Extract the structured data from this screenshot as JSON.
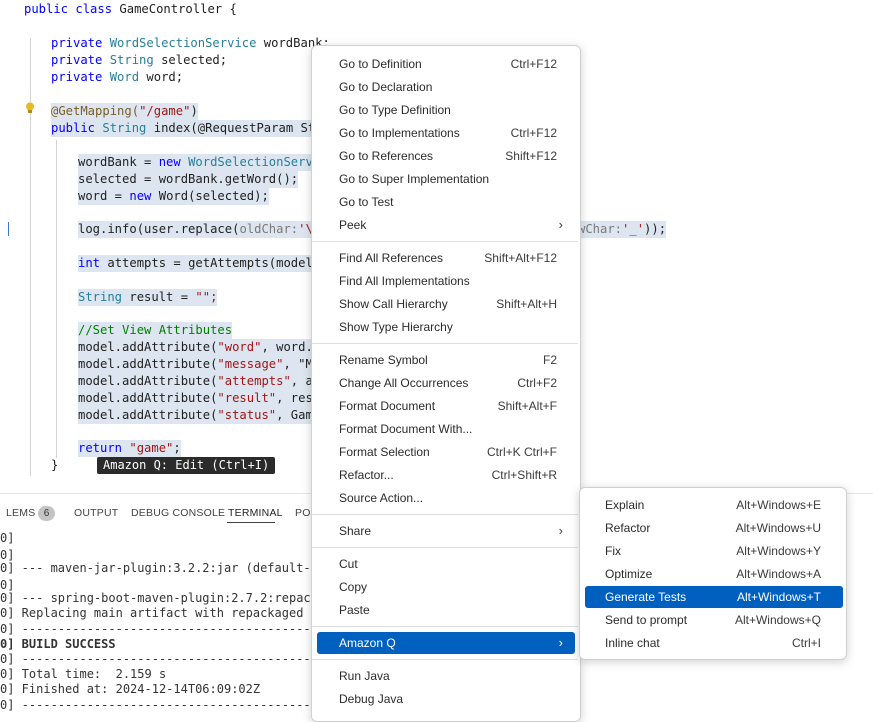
{
  "code": {
    "line1": {
      "kw": "public class ",
      "name": "GameController {"
    },
    "line2": {
      "kw": "private ",
      "ty": "WordSelectionService",
      "rest": " wordBank;"
    },
    "line3": {
      "kw": "private ",
      "ty": "String",
      "rest": " selected;"
    },
    "line4": {
      "kw": "private ",
      "ty": "Word",
      "rest": " word;"
    },
    "line5": {
      "ann": "@GetMapping(",
      "str": "\"/game\"",
      "end": ")"
    },
    "line6": {
      "kw": "public ",
      "ty": "String",
      "rest": " index(@RequestParam Stri"
    },
    "line7": {
      "a": "wordBank = ",
      "kw": "new ",
      "b": "WordSelectionServic"
    },
    "line8": {
      "a": "selected = wordBank.getWord();"
    },
    "line9": {
      "a": "word = ",
      "kw": "new ",
      "b": "Word(selected);"
    },
    "line10": {
      "a": "log.info(user.replace(",
      "param1": "oldChar:",
      "str1": "'\\n'",
      "tail_param": "wChar:",
      "str2": "'_'",
      "tail": "));"
    },
    "line11": {
      "kw": "int ",
      "a": "attempts = getAttempts(model);"
    },
    "line12": {
      "ty": "String ",
      "a": "result = ",
      "str": "\"\";"
    },
    "line13": {
      "cm": "//Set View Attributes"
    },
    "line14": {
      "a": "model.addAttribute(",
      "str": "\"word\"",
      "b": ", word.ge"
    },
    "line15": {
      "a": "model.addAttribute(",
      "str": "\"message\"",
      "b": ", \"Mak"
    },
    "line16": {
      "a": "model.addAttribute(",
      "str": "\"attempts\"",
      "b": ", att"
    },
    "line17": {
      "a": "model.addAttribute(",
      "str": "\"result\"",
      "b": ", resul"
    },
    "line18": {
      "a": "model.addAttribute(",
      "str": "\"status\"",
      "b": ", GameS"
    },
    "line19": {
      "kw": "return ",
      "str": "\"game\"",
      "end": ";"
    },
    "line20": {
      "a": "}"
    }
  },
  "amazon_q_tip": "Amazon Q: Edit (Ctrl+I)",
  "panel": {
    "tabs": [
      {
        "label": "LEMS"
      },
      {
        "label": "OUTPUT"
      },
      {
        "label": "DEBUG CONSOLE"
      },
      {
        "label": "TERMINAL"
      },
      {
        "label": "POR"
      }
    ],
    "problems_count": "6",
    "terminal_lines": [
      "0]",
      "0]",
      "0] --- maven-jar-plugin:3.2.2:jar (default-jar) @",
      "0]",
      "0] --- spring-boot-maven-plugin:2.7.2:repackage (",
      "0] Replacing main artifact with repackaged archiv",
      "0] -----------------------------------------------",
      "0] BUILD SUCCESS",
      "0] -----------------------------------------------",
      "0] Total time:  2.159 s",
      "0] Finished at: 2024-12-14T06:09:02Z",
      "0] -----------------------------------------------"
    ]
  },
  "context_menu": {
    "items": [
      {
        "label": "Go to Definition",
        "key": "Ctrl+F12"
      },
      {
        "label": "Go to Declaration",
        "key": ""
      },
      {
        "label": "Go to Type Definition",
        "key": ""
      },
      {
        "label": "Go to Implementations",
        "key": "Ctrl+F12"
      },
      {
        "label": "Go to References",
        "key": "Shift+F12"
      },
      {
        "label": "Go to Super Implementation",
        "key": ""
      },
      {
        "label": "Go to Test",
        "key": ""
      },
      {
        "label": "Peek",
        "key": ""
      },
      {
        "label": "Find All References",
        "key": "Shift+Alt+F12"
      },
      {
        "label": "Find All Implementations",
        "key": ""
      },
      {
        "label": "Show Call Hierarchy",
        "key": "Shift+Alt+H"
      },
      {
        "label": "Show Type Hierarchy",
        "key": ""
      },
      {
        "label": "Rename Symbol",
        "key": "F2"
      },
      {
        "label": "Change All Occurrences",
        "key": "Ctrl+F2"
      },
      {
        "label": "Format Document",
        "key": "Shift+Alt+F"
      },
      {
        "label": "Format Document With...",
        "key": ""
      },
      {
        "label": "Format Selection",
        "key": "Ctrl+K Ctrl+F"
      },
      {
        "label": "Refactor...",
        "key": "Ctrl+Shift+R"
      },
      {
        "label": "Source Action...",
        "key": ""
      },
      {
        "label": "Share",
        "key": ""
      },
      {
        "label": "Cut",
        "key": ""
      },
      {
        "label": "Copy",
        "key": ""
      },
      {
        "label": "Paste",
        "key": ""
      },
      {
        "label": "Amazon Q",
        "key": ""
      },
      {
        "label": "Run Java",
        "key": ""
      },
      {
        "label": "Debug Java",
        "key": ""
      }
    ]
  },
  "submenu": {
    "items": [
      {
        "label": "Explain",
        "key": "Alt+Windows+E"
      },
      {
        "label": "Refactor",
        "key": "Alt+Windows+U"
      },
      {
        "label": "Fix",
        "key": "Alt+Windows+Y"
      },
      {
        "label": "Optimize",
        "key": "Alt+Windows+A"
      },
      {
        "label": "Generate Tests",
        "key": "Alt+Windows+T"
      },
      {
        "label": "Send to prompt",
        "key": "Alt+Windows+Q"
      },
      {
        "label": "Inline chat",
        "key": "Ctrl+I"
      }
    ]
  },
  "colors": {
    "selection": "#0060c0",
    "keyword": "#0000ff",
    "type": "#267f99",
    "string": "#a31515"
  }
}
